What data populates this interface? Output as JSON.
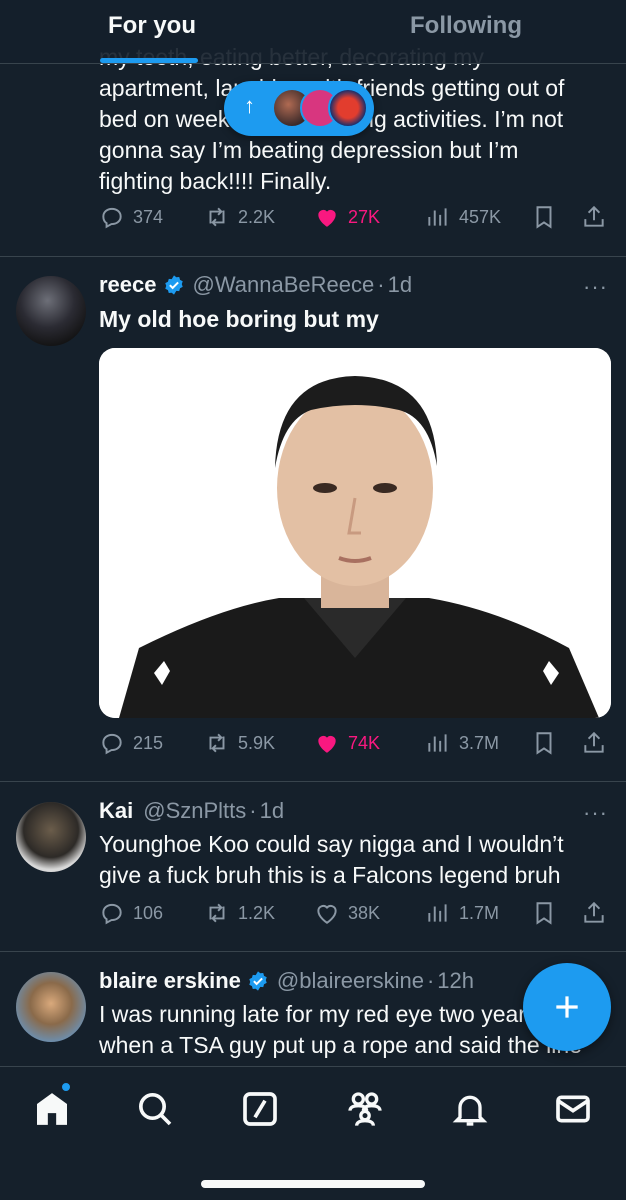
{
  "tabs": {
    "foryou": "For you",
    "following": "Following"
  },
  "tweet1": {
    "text_lines": [
      "my teeth, eating better, decorating my",
      "apartment, laughing with friends getting out of",
      "bed on weekends and doing activities. I’m not",
      "gonna say I’m beating depression but I’m",
      "fighting back!!!! Finally."
    ],
    "replies": "374",
    "reposts": "2.2K",
    "likes": "27K",
    "views": "457K"
  },
  "tweet2": {
    "name": "reece",
    "verified": true,
    "handle": "@WannaBeReece",
    "time": "1d",
    "text": "My old hoe boring but my",
    "replies": "215",
    "reposts": "5.9K",
    "likes": "74K",
    "views": "3.7M"
  },
  "tweet3": {
    "name": "Kai",
    "handle": "@SznPltts",
    "time": "1d",
    "text_lines": [
      "Younghoe Koo could say nigga and I wouldn’t",
      "give a fuck bruh this is a Falcons legend bruh"
    ],
    "replies": "106",
    "reposts": "1.2K",
    "likes": "38K",
    "views": "1.7M"
  },
  "tweet4": {
    "name": "blaire erskine",
    "verified": true,
    "handle": "@blaireerskine",
    "time": "12h",
    "text_lines": [
      "I was running late for my red eye two years ago",
      "when a TSA guy put up a rope and said the line"
    ]
  },
  "more": "···",
  "dot": "·",
  "colors": {
    "background": "#15202b",
    "accent": "#1d9bf0",
    "like": "#f91880",
    "muted": "#8b98a5"
  },
  "icons": [
    "reply-icon",
    "repost-icon",
    "like-icon",
    "views-icon",
    "bookmark-icon",
    "share-icon",
    "verified-badge-icon",
    "home-icon",
    "search-icon",
    "grok-icon",
    "communities-icon",
    "notifications-icon",
    "messages-icon",
    "compose-plus-icon"
  ]
}
